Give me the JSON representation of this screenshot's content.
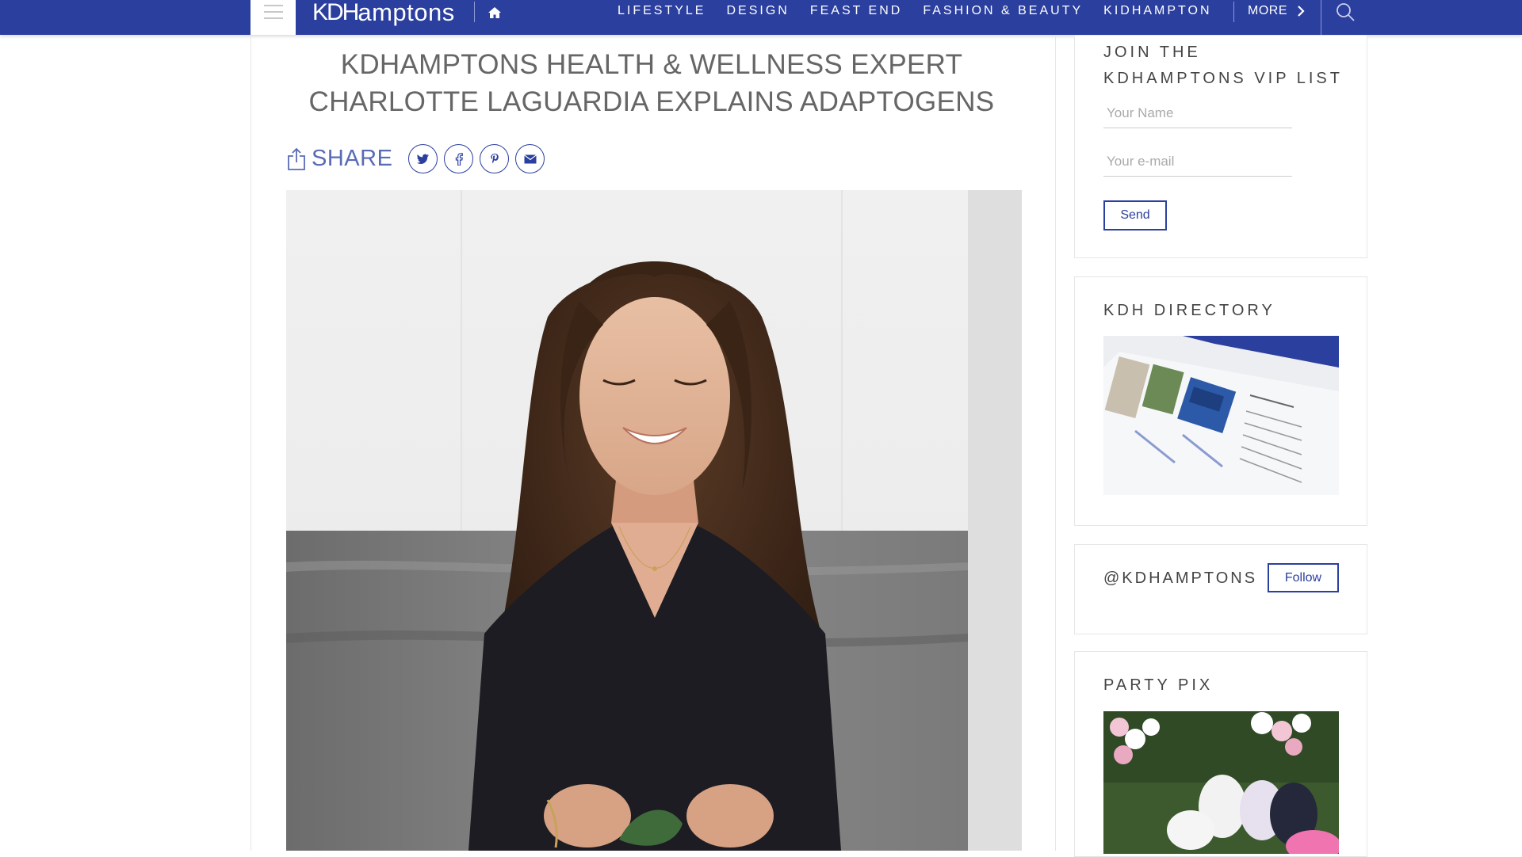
{
  "header": {
    "logo_kd": "KDH",
    "logo_rest": "amptons",
    "nav": [
      "LIFESTYLE",
      "DESIGN",
      "FEAST END",
      "FASHION & BEAUTY",
      "KIDHAMPTON"
    ],
    "more": "MORE"
  },
  "article": {
    "title": "KDHAMPTONS HEALTH & WELLNESS EXPERT CHARLOTTE LAGUARDIA EXPLAINS ADAPTOGENS",
    "share_label": "SHARE",
    "social_icons": [
      "twitter-icon",
      "facebook-icon",
      "pinterest-icon",
      "email-icon"
    ]
  },
  "sidebar": {
    "vip": {
      "title": "JOIN THE KDHAMPTONS VIP LIST",
      "name_placeholder": "Your Name",
      "email_placeholder": "Your e-mail",
      "send_label": "Send"
    },
    "directory": {
      "title": "KDH DIRECTORY"
    },
    "instagram": {
      "handle": "@KDHAMPTONS",
      "follow_label": "Follow"
    },
    "party": {
      "title": "PARTY PIX"
    }
  },
  "colors": {
    "brand": "#2b3f9e",
    "share_text": "#5a6bb6"
  }
}
